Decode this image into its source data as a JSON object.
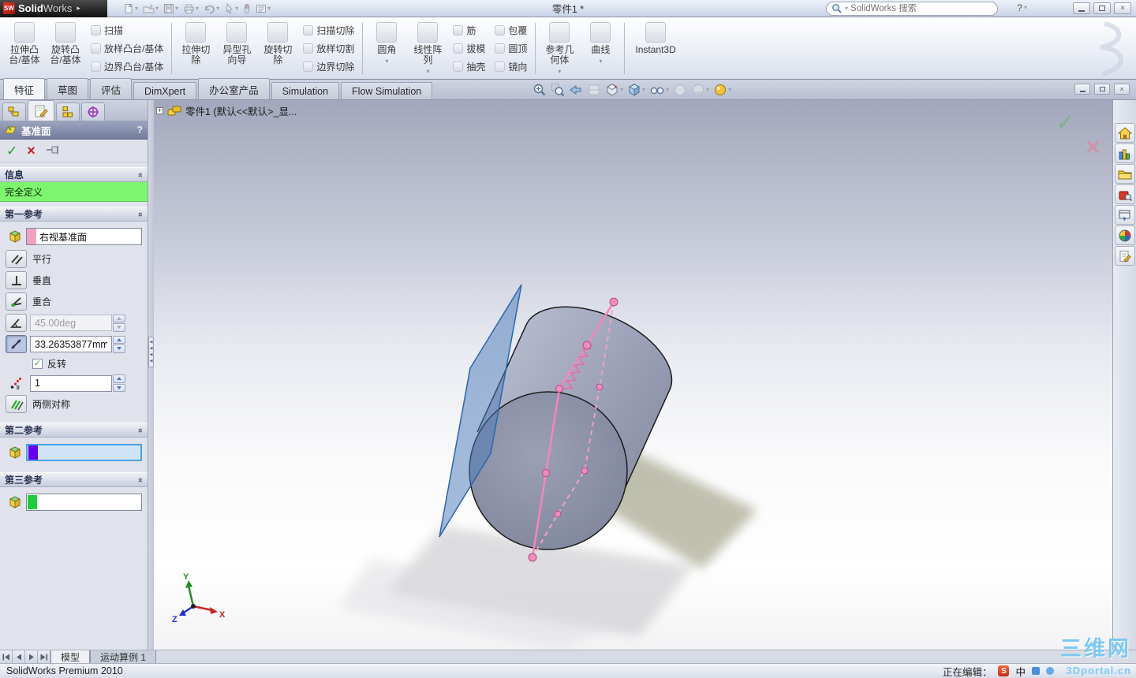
{
  "title_bar": {
    "logo_prefix": "SW",
    "app_name_bold": "Solid",
    "app_name_light": "Works",
    "document_title": "零件1 *",
    "search_placeholder": "SolidWorks 搜索",
    "help_label": "?"
  },
  "ribbon": {
    "big_buttons": [
      "拉伸凸台/基体",
      "旋转凸台/基体",
      "拉伸切除",
      "异型孔向导",
      "旋转切除",
      "圆角",
      "线性阵列",
      "参考几何体",
      "曲线",
      "Instant3D"
    ],
    "stacks": [
      [
        "扫描",
        "放样凸台/基体",
        "边界凸台/基体"
      ],
      [
        "扫描切除",
        "放样切割",
        "边界切除"
      ],
      [
        "筋",
        "拔模",
        "抽壳"
      ],
      [
        "包覆",
        "圆顶",
        "镜向"
      ]
    ]
  },
  "command_tabs": {
    "items": [
      "特征",
      "草图",
      "评估",
      "DimXpert",
      "办公室产品",
      "Simulation",
      "Flow Simulation"
    ],
    "active": "特征"
  },
  "property_manager": {
    "title": "基准面",
    "help_label": "?",
    "info": {
      "label": "信息",
      "message": "完全定义"
    },
    "first_reference": {
      "label": "第一参考",
      "selection": "右视基准面",
      "parallel": "平行",
      "perpendicular": "垂直",
      "coincident": "重合",
      "angle_value": "45.00deg",
      "distance_value": "33.26353877mm",
      "flip_label": "反转",
      "count_value": "1",
      "midplane_label": "两侧对称"
    },
    "second_reference": {
      "label": "第二参考"
    },
    "third_reference": {
      "label": "第三参考"
    }
  },
  "viewport": {
    "feature_tree_flyout": "零件1 (默认<<默认>_显...",
    "triad": {
      "x": "X",
      "y": "Y",
      "z": "Z"
    }
  },
  "task_pane_icons": [
    "solidworks-resources",
    "design-library",
    "file-explorer",
    "search-toolbox",
    "view-palette",
    "appearances-scenes",
    "custom-properties"
  ],
  "heads_up_icons": [
    "zoom-fit",
    "zoom-area",
    "previous-view",
    "section-view",
    "view-orientation",
    "display-style",
    "hide-show-items",
    "edit-appearance",
    "apply-scene",
    "view-settings"
  ],
  "quick_toolbar_icons": [
    "new-document",
    "open",
    "save",
    "print",
    "undo",
    "select",
    "measure",
    "options"
  ],
  "bottom_bar": {
    "tabs": [
      {
        "label": "模型",
        "active": true
      },
      {
        "label": "运动算例 1",
        "active": false
      }
    ]
  },
  "status_bar": {
    "product": "SolidWorks Premium 2010",
    "editing_label": "正在编辑：",
    "ime_sogou": "S",
    "ime_lang": "中"
  },
  "watermark": {
    "line1": "三维网",
    "line2": "3Dportal.cn"
  },
  "colors": {
    "selection_pink": "#f2a0c0",
    "active_field_blue": "#4aa0e8",
    "fully_defined_green": "#7df56e",
    "second_ref_marker": "#6600e6",
    "third_ref_marker": "#21cc3a",
    "spline_pink": "#f184b9",
    "plane_blue": "#3a77c2",
    "cylinder_gray": "#9096ae"
  },
  "icons_glyphs": {
    "caret_down": "▾",
    "collapse_chevron": "»",
    "ok": "✓",
    "cancel": "×",
    "expand_plus": "+",
    "window_close": "×",
    "menu_arrow": "▸",
    "nav_first": "◀",
    "nav_prev": "◀",
    "nav_next": "▶",
    "nav_last": "▶",
    "splitter_arrow": "◀"
  }
}
